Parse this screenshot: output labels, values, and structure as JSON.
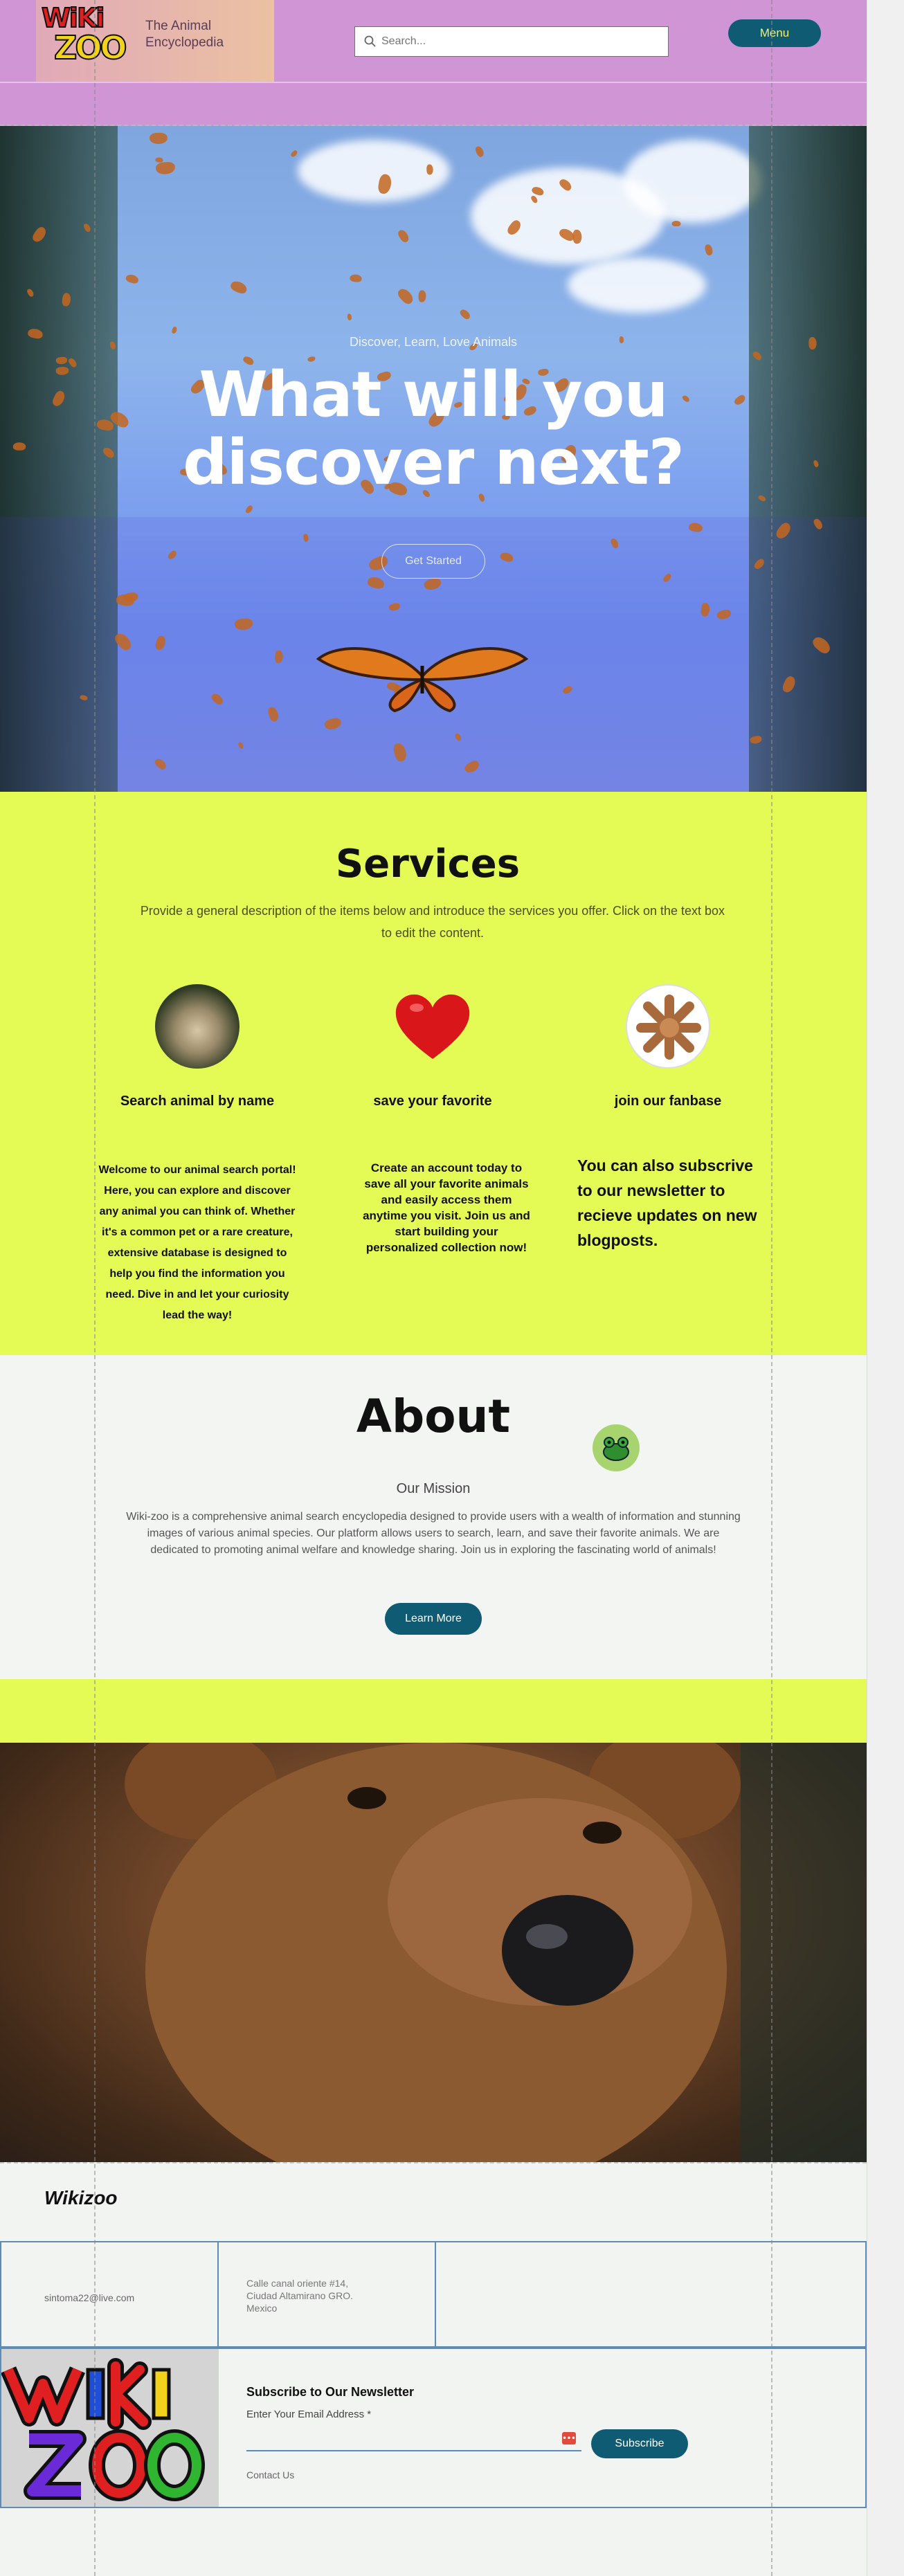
{
  "header": {
    "logo_line1": "WiKi",
    "logo_line2": "ZOO",
    "tagline": "The Animal Encyclopedia",
    "search_placeholder": "Search...",
    "menu_label": "Menu"
  },
  "hero": {
    "kicker": "Discover, Learn, Love Animals",
    "title": "What will you discover next?",
    "button": "Get Started"
  },
  "anchor_glyph": "↕",
  "services": {
    "title": "Services",
    "description": "Provide a general description of the items below and introduce the services you offer. Click on the text box to edit the content.",
    "items": [
      {
        "title": "Search animal by name",
        "text": "Welcome to our animal search portal! Here, you can explore and discover any animal you can think of. Whether it's a common pet or a rare creature, extensive database is designed to help you find the information you need. Dive in and let your curiosity lead the way!",
        "icon": "hamster-image"
      },
      {
        "title": "save your favorite",
        "text": "Create an account today to save all your favorite animals and easily access them anytime you visit. Join us and start building your personalized collection now!",
        "icon": "heart-icon"
      },
      {
        "title": "join our fanbase",
        "text": "You can also subscrive to our newsletter to recieve updates on new blogposts.",
        "icon": "hands-together-image"
      }
    ]
  },
  "about": {
    "title": "About",
    "subtitle": "Our Mission",
    "body": "Wiki-zoo is a comprehensive animal search encyclopedia designed to provide users with a wealth of information and stunning images of various animal species. Our platform allows users to search, learn, and save their favorite animals. We are dedicated to promoting animal welfare and knowledge sharing. Join us in exploring the fascinating world of animals!",
    "button": "Learn More"
  },
  "footer": {
    "brand": "Wikizoo",
    "email": "sintoma22@live.com",
    "address": "Calle canal oriente #14,\nCiudad Altamirano GRO.\nMexico",
    "newsletter_title": "Subscribe to Our Newsletter",
    "email_label": "Enter Your Email Address *",
    "subscribe_button": "Subscribe",
    "contact_link": "Contact Us",
    "dots_glyph": "•••"
  },
  "colors": {
    "header_bg": "#cf95d4",
    "lime": "#e5fb55",
    "teal_button": "#0f5b73",
    "menu_text": "#f3ef6a"
  }
}
